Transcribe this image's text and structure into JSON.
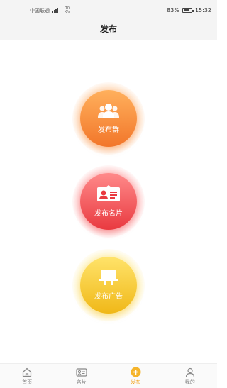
{
  "status_bar": {
    "carrier": "中国联通",
    "network_speed_value": "70",
    "network_speed_unit": "K/s",
    "battery": "83%",
    "time": "15:32"
  },
  "header": {
    "title": "发布"
  },
  "actions": [
    {
      "label": "发布群",
      "icon": "group-icon",
      "color": "#f2762a"
    },
    {
      "label": "发布名片",
      "icon": "business-card-icon",
      "color": "#e93a40"
    },
    {
      "label": "发布广告",
      "icon": "billboard-icon",
      "color": "#f0b818"
    }
  ],
  "tabbar": {
    "items": [
      {
        "label": "首页",
        "icon": "home-icon",
        "active": false
      },
      {
        "label": "名片",
        "icon": "card-icon",
        "active": false
      },
      {
        "label": "发布",
        "icon": "plus-circle-icon",
        "active": true
      },
      {
        "label": "我的",
        "icon": "user-icon",
        "active": false
      }
    ],
    "active_color": "#f2a21b",
    "inactive_color": "#888888"
  }
}
